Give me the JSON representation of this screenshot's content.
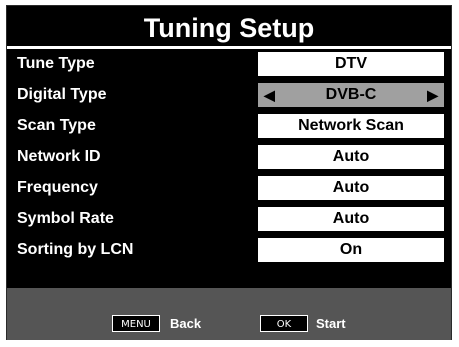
{
  "title": "Tuning Setup",
  "rows": [
    {
      "label": "Tune Type",
      "value": "DTV"
    },
    {
      "label": "Digital Type",
      "value": "DVB-C",
      "left_arrow": "◀",
      "right_arrow": "▶"
    },
    {
      "label": "Scan Type",
      "value": "Network Scan"
    },
    {
      "label": "Network ID",
      "value": "Auto"
    },
    {
      "label": "Frequency",
      "value": "Auto"
    },
    {
      "label": "Symbol Rate",
      "value": "Auto"
    },
    {
      "label": "Sorting by LCN",
      "value": "On"
    }
  ],
  "footer": {
    "menu_key": "MENU",
    "menu_label": "Back",
    "ok_key": "OK",
    "ok_label": "Start"
  },
  "colors": {
    "background": "#000000",
    "value_box": "#ffffff",
    "selected_value_box": "#a0a0a0",
    "footer_bar": "#555555",
    "text": "#ffffff"
  }
}
